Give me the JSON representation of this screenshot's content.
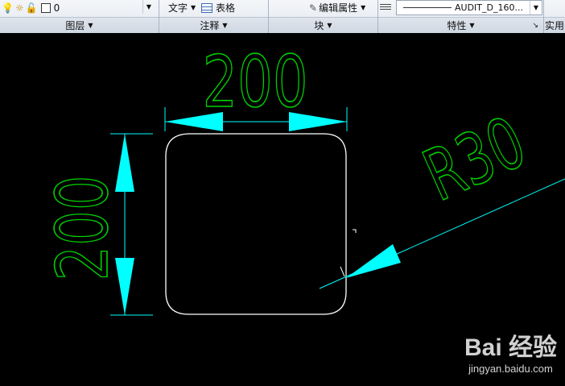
{
  "ribbon": {
    "layer_value": "0",
    "text_label": "文字",
    "table_label": "表格",
    "edit_attr_label": "编辑属性",
    "linetype_value": "AUDIT_D_160...",
    "panels": {
      "layers": "图层",
      "annotation": "注释",
      "block": "块",
      "properties": "特性",
      "utilities": "实用"
    }
  },
  "drawing": {
    "dim_top": "200",
    "dim_left": "200",
    "dim_radius": "R30",
    "colors": {
      "dim": "#00ffff",
      "text": "#00d000",
      "geometry": "#ffffff"
    }
  },
  "watermark": {
    "logo": "Bai 经验",
    "url": "jingyan.baidu.com"
  }
}
